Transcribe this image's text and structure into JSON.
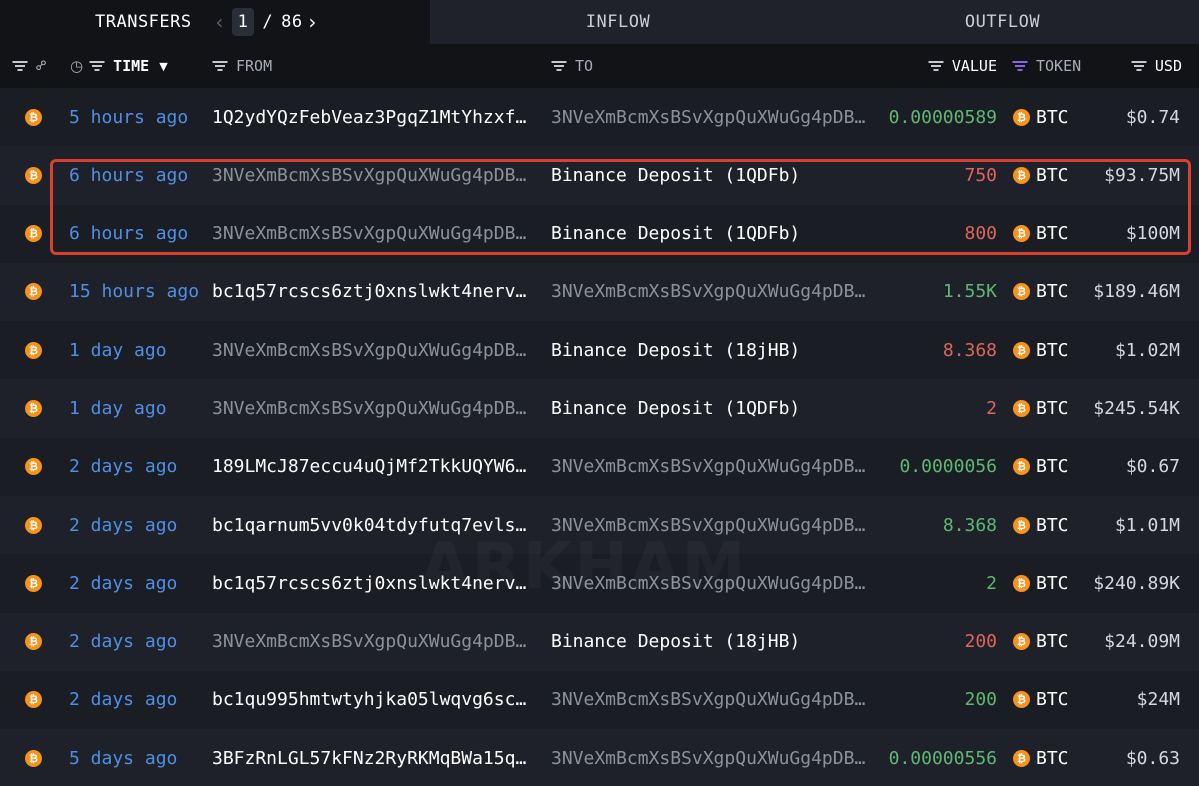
{
  "tabs": {
    "transfers": "TRANSFERS",
    "inflow": "INFLOW",
    "outflow": "OUTFLOW"
  },
  "pager": {
    "current": "1",
    "separator": "/",
    "total": "86"
  },
  "columns": {
    "time": "TIME",
    "from": "FROM",
    "to": "TO",
    "value": "VALUE",
    "token": "TOKEN",
    "usd": "USD"
  },
  "icons": {
    "filter": "filter-icon",
    "link": "link-icon",
    "clock": "clock-icon",
    "sort": "caret-down-icon",
    "btc": "bitcoin-icon"
  },
  "colors": {
    "accent_time": "#4f8fe6",
    "value_in": "#5fb872",
    "value_out": "#e0655a",
    "btc": "#f7931a",
    "highlight": "#d9412e",
    "token_filter": "#8a63e6"
  },
  "watermark": "ARKHAM",
  "rows": [
    {
      "time": "5 hours ago",
      "from": "1Q2ydYQzFebVeaz3PgqZ1MtYhzxfU…",
      "from_muted": false,
      "to": "3NVeXmBcmXsBSvXgpQuXWuGg4pDBD…",
      "to_muted": true,
      "value": "0.00000589",
      "direction": "in",
      "token": "BTC",
      "usd": "$0.74"
    },
    {
      "time": "6 hours ago",
      "from": "3NVeXmBcmXsBSvXgpQuXWuGg4pDBD…",
      "from_muted": true,
      "to": "Binance Deposit (1QDFb)",
      "to_muted": false,
      "value": "750",
      "direction": "out",
      "token": "BTC",
      "usd": "$93.75M"
    },
    {
      "time": "6 hours ago",
      "from": "3NVeXmBcmXsBSvXgpQuXWuGg4pDBD…",
      "from_muted": true,
      "to": "Binance Deposit (1QDFb)",
      "to_muted": false,
      "value": "800",
      "direction": "out",
      "token": "BTC",
      "usd": "$100M"
    },
    {
      "time": "15 hours ago",
      "from": "bc1q57rcscs6ztj0xnslwkt4nervx…",
      "from_muted": false,
      "to": "3NVeXmBcmXsBSvXgpQuXWuGg4pDBD…",
      "to_muted": true,
      "value": "1.55K",
      "direction": "in",
      "token": "BTC",
      "usd": "$189.46M"
    },
    {
      "time": "1 day ago",
      "from": "3NVeXmBcmXsBSvXgpQuXWuGg4pDBD…",
      "from_muted": true,
      "to": "Binance Deposit (18jHB)",
      "to_muted": false,
      "value": "8.368",
      "direction": "out",
      "token": "BTC",
      "usd": "$1.02M"
    },
    {
      "time": "1 day ago",
      "from": "3NVeXmBcmXsBSvXgpQuXWuGg4pDBD…",
      "from_muted": true,
      "to": "Binance Deposit (1QDFb)",
      "to_muted": false,
      "value": "2",
      "direction": "out",
      "token": "BTC",
      "usd": "$245.54K"
    },
    {
      "time": "2 days ago",
      "from": "189LMcJ87eccu4uQjMf2TkkUQYW6U…",
      "from_muted": false,
      "to": "3NVeXmBcmXsBSvXgpQuXWuGg4pDBD…",
      "to_muted": true,
      "value": "0.0000056",
      "direction": "in",
      "token": "BTC",
      "usd": "$0.67"
    },
    {
      "time": "2 days ago",
      "from": "bc1qarnum5vv0k04tdyfutq7evls7…",
      "from_muted": false,
      "to": "3NVeXmBcmXsBSvXgpQuXWuGg4pDBD…",
      "to_muted": true,
      "value": "8.368",
      "direction": "in",
      "token": "BTC",
      "usd": "$1.01M"
    },
    {
      "time": "2 days ago",
      "from": "bc1q57rcscs6ztj0xnslwkt4nervx…",
      "from_muted": false,
      "to": "3NVeXmBcmXsBSvXgpQuXWuGg4pDBD…",
      "to_muted": true,
      "value": "2",
      "direction": "in",
      "token": "BTC",
      "usd": "$240.89K"
    },
    {
      "time": "2 days ago",
      "from": "3NVeXmBcmXsBSvXgpQuXWuGg4pDBD…",
      "from_muted": true,
      "to": "Binance Deposit (18jHB)",
      "to_muted": false,
      "value": "200",
      "direction": "out",
      "token": "BTC",
      "usd": "$24.09M"
    },
    {
      "time": "2 days ago",
      "from": "bc1qu995hmtwtyhjka05lwqvg6sck…",
      "from_muted": false,
      "to": "3NVeXmBcmXsBSvXgpQuXWuGg4pDBD…",
      "to_muted": true,
      "value": "200",
      "direction": "in",
      "token": "BTC",
      "usd": "$24M"
    },
    {
      "time": "5 days ago",
      "from": "3BFzRnLGL57kFNz2RyRKMqBWa15qA…",
      "from_muted": false,
      "to": "3NVeXmBcmXsBSvXgpQuXWuGg4pDBD…",
      "to_muted": true,
      "value": "0.00000556",
      "direction": "in",
      "token": "BTC",
      "usd": "$0.63"
    }
  ]
}
